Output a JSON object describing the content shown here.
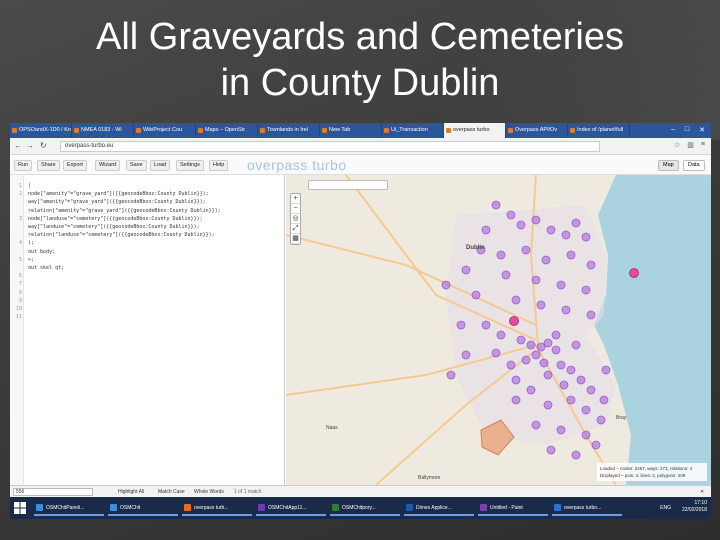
{
  "slide": {
    "title_line1": "All Graveyards and Cemeteries",
    "title_line2": "in County Dublin"
  },
  "browser": {
    "tabs": [
      {
        "label": "OPSOandX-1D0 / Kn"
      },
      {
        "label": "NMEA 0183 - Wi"
      },
      {
        "label": "WikiProject Cou"
      },
      {
        "label": "Maps – OpenStr"
      },
      {
        "label": "Townlands in Irel"
      },
      {
        "label": "New Tab"
      },
      {
        "label": "Ui_Transaction"
      },
      {
        "label": "overpass turbo",
        "active": true
      },
      {
        "label": "Overpass API/Ov"
      },
      {
        "label": "Index of /planet/full"
      }
    ],
    "url": "overpass-turbo.eu"
  },
  "toolbar": {
    "run": "Run",
    "share": "Share",
    "export": "Export",
    "wizard": "Wizard",
    "save": "Save",
    "load": "Load",
    "settings": "Settings",
    "help": "Help",
    "brand": "overpass turbo",
    "map_tab": "Map",
    "data_tab": "Data"
  },
  "editor": {
    "lines": [
      {
        "n": "1",
        "text": "("
      },
      {
        "n": "2",
        "text": "node[\"amenity\"=\"grave_yard\"]({{geocodeBbox:County Dublin}});"
      },
      {
        "n": "",
        "text": "way[\"amenity\"=\"grave_yard\"]({{geocodeBbox:County Dublin}});"
      },
      {
        "n": "",
        "text": "relation[\"amenity\"=\"grave_yard\"]({{geocodeBbox:County Dublin}});"
      },
      {
        "n": "3",
        "text": "node[\"landuse\"=\"cemetery\"]({{geocodeBbox:County Dublin}});"
      },
      {
        "n": "",
        "text": "way[\"landuse\"=\"cemetery\"]({{geocodeBbox:County Dublin}});"
      },
      {
        "n": "",
        "text": "relation[\"landuse\"=\"cemetery\"]({{geocodeBbox:County Dublin}});"
      },
      {
        "n": "4",
        "text": ");"
      },
      {
        "n": "",
        "text": "out body;"
      },
      {
        "n": "5",
        "text": ">;"
      },
      {
        "n": "",
        "text": "out skel qt;"
      },
      {
        "n": "6",
        "text": ""
      },
      {
        "n": "7",
        "text": ""
      },
      {
        "n": "8",
        "text": ""
      },
      {
        "n": "9",
        "text": ""
      },
      {
        "n": "10",
        "text": ""
      },
      {
        "n": "11",
        "text": ""
      }
    ]
  },
  "map": {
    "search_placeholder": "",
    "places": [
      {
        "name": "Dublin"
      },
      {
        "name": "Naas"
      },
      {
        "name": "Bray"
      },
      {
        "name": "Ballymore"
      }
    ],
    "stats_line1": "Loaded – nodes: 2267, ways: 273, relations: 4",
    "stats_line2": "Displayed – pois: 4, lines: 2, polygons: 209"
  },
  "findbar": {
    "query": "556",
    "highlight_all": "Highlight All",
    "match_case": "Match Case",
    "whole_words": "Whole Words",
    "result": "1 of 1 match"
  },
  "taskbar": {
    "items": [
      {
        "label": "OSMChitPaneli..."
      },
      {
        "label": "OSMChit"
      },
      {
        "label": "overpass turb..."
      },
      {
        "label": "OSMChitApp11..."
      },
      {
        "label": "OSMChitpory..."
      },
      {
        "label": "Dimes Applice..."
      },
      {
        "label": "Untitled - Paint"
      },
      {
        "label": "overpass turbo..."
      }
    ],
    "time": "17:10",
    "date": "22/02/2018",
    "lang": "ENG"
  },
  "colors": {
    "marker_fill": "#b07fd6",
    "marker_stroke": "#8a2be2",
    "marker_pink": "#e04f9f",
    "taskbar": "#1a2b4a",
    "tabbar": "#2b579a"
  }
}
